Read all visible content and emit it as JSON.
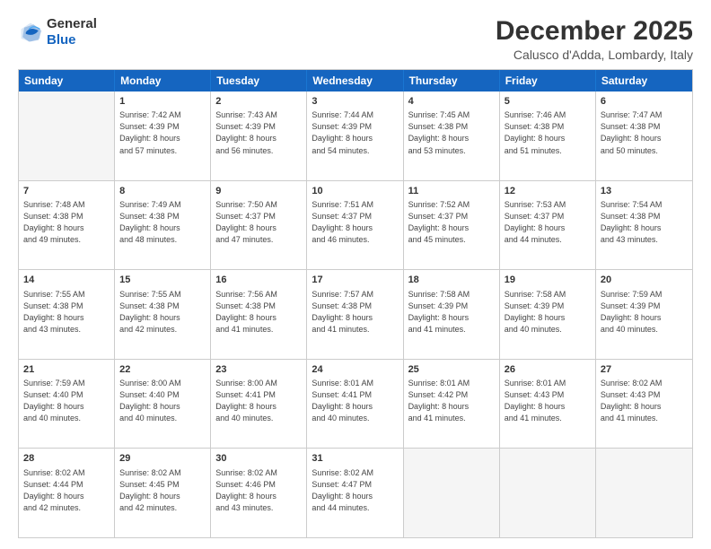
{
  "logo": {
    "general": "General",
    "blue": "Blue"
  },
  "header": {
    "title": "December 2025",
    "location": "Calusco d'Adda, Lombardy, Italy"
  },
  "days_of_week": [
    "Sunday",
    "Monday",
    "Tuesday",
    "Wednesday",
    "Thursday",
    "Friday",
    "Saturday"
  ],
  "weeks": [
    [
      {
        "day": "",
        "sunrise": "",
        "sunset": "",
        "daylight": ""
      },
      {
        "day": "1",
        "sunrise": "Sunrise: 7:42 AM",
        "sunset": "Sunset: 4:39 PM",
        "daylight": "Daylight: 8 hours and 57 minutes."
      },
      {
        "day": "2",
        "sunrise": "Sunrise: 7:43 AM",
        "sunset": "Sunset: 4:39 PM",
        "daylight": "Daylight: 8 hours and 56 minutes."
      },
      {
        "day": "3",
        "sunrise": "Sunrise: 7:44 AM",
        "sunset": "Sunset: 4:39 PM",
        "daylight": "Daylight: 8 hours and 54 minutes."
      },
      {
        "day": "4",
        "sunrise": "Sunrise: 7:45 AM",
        "sunset": "Sunset: 4:38 PM",
        "daylight": "Daylight: 8 hours and 53 minutes."
      },
      {
        "day": "5",
        "sunrise": "Sunrise: 7:46 AM",
        "sunset": "Sunset: 4:38 PM",
        "daylight": "Daylight: 8 hours and 51 minutes."
      },
      {
        "day": "6",
        "sunrise": "Sunrise: 7:47 AM",
        "sunset": "Sunset: 4:38 PM",
        "daylight": "Daylight: 8 hours and 50 minutes."
      }
    ],
    [
      {
        "day": "7",
        "sunrise": "Sunrise: 7:48 AM",
        "sunset": "Sunset: 4:38 PM",
        "daylight": "Daylight: 8 hours and 49 minutes."
      },
      {
        "day": "8",
        "sunrise": "Sunrise: 7:49 AM",
        "sunset": "Sunset: 4:38 PM",
        "daylight": "Daylight: 8 hours and 48 minutes."
      },
      {
        "day": "9",
        "sunrise": "Sunrise: 7:50 AM",
        "sunset": "Sunset: 4:37 PM",
        "daylight": "Daylight: 8 hours and 47 minutes."
      },
      {
        "day": "10",
        "sunrise": "Sunrise: 7:51 AM",
        "sunset": "Sunset: 4:37 PM",
        "daylight": "Daylight: 8 hours and 46 minutes."
      },
      {
        "day": "11",
        "sunrise": "Sunrise: 7:52 AM",
        "sunset": "Sunset: 4:37 PM",
        "daylight": "Daylight: 8 hours and 45 minutes."
      },
      {
        "day": "12",
        "sunrise": "Sunrise: 7:53 AM",
        "sunset": "Sunset: 4:37 PM",
        "daylight": "Daylight: 8 hours and 44 minutes."
      },
      {
        "day": "13",
        "sunrise": "Sunrise: 7:54 AM",
        "sunset": "Sunset: 4:38 PM",
        "daylight": "Daylight: 8 hours and 43 minutes."
      }
    ],
    [
      {
        "day": "14",
        "sunrise": "Sunrise: 7:55 AM",
        "sunset": "Sunset: 4:38 PM",
        "daylight": "Daylight: 8 hours and 43 minutes."
      },
      {
        "day": "15",
        "sunrise": "Sunrise: 7:55 AM",
        "sunset": "Sunset: 4:38 PM",
        "daylight": "Daylight: 8 hours and 42 minutes."
      },
      {
        "day": "16",
        "sunrise": "Sunrise: 7:56 AM",
        "sunset": "Sunset: 4:38 PM",
        "daylight": "Daylight: 8 hours and 41 minutes."
      },
      {
        "day": "17",
        "sunrise": "Sunrise: 7:57 AM",
        "sunset": "Sunset: 4:38 PM",
        "daylight": "Daylight: 8 hours and 41 minutes."
      },
      {
        "day": "18",
        "sunrise": "Sunrise: 7:58 AM",
        "sunset": "Sunset: 4:39 PM",
        "daylight": "Daylight: 8 hours and 41 minutes."
      },
      {
        "day": "19",
        "sunrise": "Sunrise: 7:58 AM",
        "sunset": "Sunset: 4:39 PM",
        "daylight": "Daylight: 8 hours and 40 minutes."
      },
      {
        "day": "20",
        "sunrise": "Sunrise: 7:59 AM",
        "sunset": "Sunset: 4:39 PM",
        "daylight": "Daylight: 8 hours and 40 minutes."
      }
    ],
    [
      {
        "day": "21",
        "sunrise": "Sunrise: 7:59 AM",
        "sunset": "Sunset: 4:40 PM",
        "daylight": "Daylight: 8 hours and 40 minutes."
      },
      {
        "day": "22",
        "sunrise": "Sunrise: 8:00 AM",
        "sunset": "Sunset: 4:40 PM",
        "daylight": "Daylight: 8 hours and 40 minutes."
      },
      {
        "day": "23",
        "sunrise": "Sunrise: 8:00 AM",
        "sunset": "Sunset: 4:41 PM",
        "daylight": "Daylight: 8 hours and 40 minutes."
      },
      {
        "day": "24",
        "sunrise": "Sunrise: 8:01 AM",
        "sunset": "Sunset: 4:41 PM",
        "daylight": "Daylight: 8 hours and 40 minutes."
      },
      {
        "day": "25",
        "sunrise": "Sunrise: 8:01 AM",
        "sunset": "Sunset: 4:42 PM",
        "daylight": "Daylight: 8 hours and 41 minutes."
      },
      {
        "day": "26",
        "sunrise": "Sunrise: 8:01 AM",
        "sunset": "Sunset: 4:43 PM",
        "daylight": "Daylight: 8 hours and 41 minutes."
      },
      {
        "day": "27",
        "sunrise": "Sunrise: 8:02 AM",
        "sunset": "Sunset: 4:43 PM",
        "daylight": "Daylight: 8 hours and 41 minutes."
      }
    ],
    [
      {
        "day": "28",
        "sunrise": "Sunrise: 8:02 AM",
        "sunset": "Sunset: 4:44 PM",
        "daylight": "Daylight: 8 hours and 42 minutes."
      },
      {
        "day": "29",
        "sunrise": "Sunrise: 8:02 AM",
        "sunset": "Sunset: 4:45 PM",
        "daylight": "Daylight: 8 hours and 42 minutes."
      },
      {
        "day": "30",
        "sunrise": "Sunrise: 8:02 AM",
        "sunset": "Sunset: 4:46 PM",
        "daylight": "Daylight: 8 hours and 43 minutes."
      },
      {
        "day": "31",
        "sunrise": "Sunrise: 8:02 AM",
        "sunset": "Sunset: 4:47 PM",
        "daylight": "Daylight: 8 hours and 44 minutes."
      },
      {
        "day": "",
        "sunrise": "",
        "sunset": "",
        "daylight": ""
      },
      {
        "day": "",
        "sunrise": "",
        "sunset": "",
        "daylight": ""
      },
      {
        "day": "",
        "sunrise": "",
        "sunset": "",
        "daylight": ""
      }
    ]
  ]
}
